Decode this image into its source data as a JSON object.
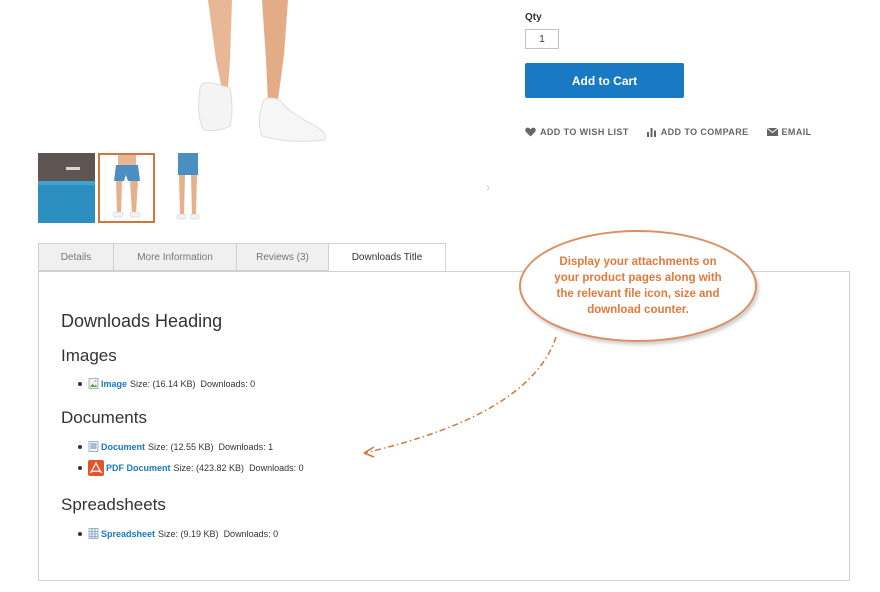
{
  "buy_box": {
    "qty_label": "Qty",
    "qty_value": "1",
    "add_to_cart_label": "Add to Cart"
  },
  "actions": {
    "wishlist_label": "ADD TO WISH LIST",
    "compare_label": "ADD TO COMPARE",
    "email_label": "EMAIL"
  },
  "gallery": {
    "thumbnail_count": 3,
    "active_thumbnail": 2,
    "next_arrow": "›"
  },
  "tabs": [
    {
      "label": "Details"
    },
    {
      "label": "More Information"
    },
    {
      "label": "Reviews (3)"
    },
    {
      "label": "Downloads Title",
      "active": true
    }
  ],
  "downloads": {
    "heading": "Downloads Heading",
    "sections": [
      {
        "title": "Images",
        "files": [
          {
            "name": "Image",
            "size": "Size: (16.14 KB)",
            "downloads": "Downloads: 0",
            "icon": "image-file-icon"
          }
        ]
      },
      {
        "title": "Documents",
        "files": [
          {
            "name": "Document",
            "size": "Size: (12.55 KB)",
            "downloads": "Downloads: 1",
            "icon": "document-file-icon"
          },
          {
            "name": "PDF Document",
            "size": "Size: (423.82 KB)",
            "downloads": "Downloads: 0",
            "icon": "pdf-file-icon"
          }
        ]
      },
      {
        "title": "Spreadsheets",
        "files": [
          {
            "name": "Spreadsheet",
            "size": "Size: (9.19 KB)",
            "downloads": "Downloads: 0",
            "icon": "spreadsheet-file-icon"
          }
        ]
      }
    ]
  },
  "callout": {
    "text": "Display your attachments on your product pages along with the relevant file icon, size and download counter."
  },
  "colors": {
    "accent": "#1979c3",
    "callout_orange": "#e07a3d",
    "active_thumb_border": "#d4763b"
  }
}
